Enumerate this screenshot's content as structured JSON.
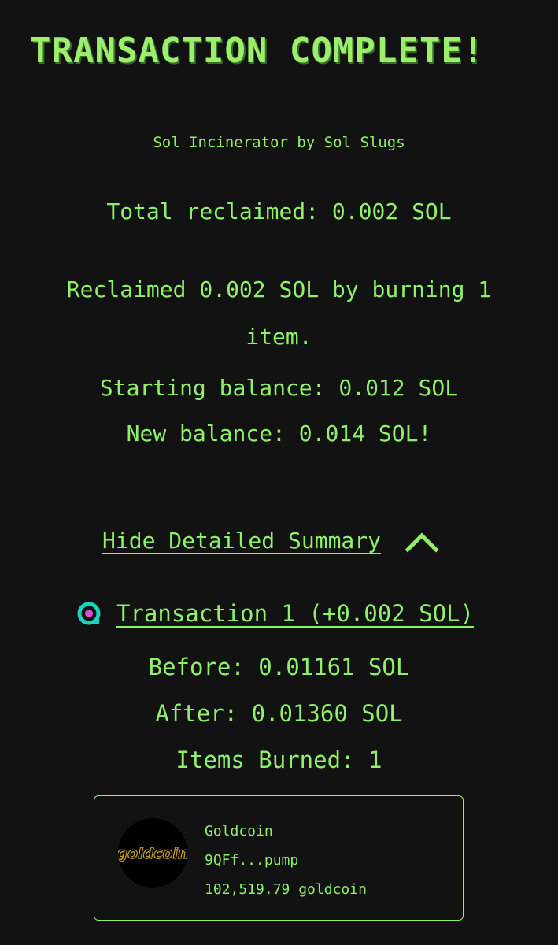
{
  "header": {
    "title": "TRANSACTION COMPLETE!",
    "subtitle": "Sol Incinerator by Sol Slugs"
  },
  "results": {
    "total_reclaimed": "Total reclaimed: 0.002 SOL",
    "reclaimed_message": "Reclaimed 0.002 SOL by burning 1 item.",
    "starting_balance": "Starting balance: 0.012 SOL",
    "new_balance": "New balance: 0.014 SOL!"
  },
  "summary": {
    "toggle_label": "Hide Detailed Summary",
    "toggle_icon": "chevron-up-icon"
  },
  "transaction": {
    "link_label": "Transaction 1 (+0.002 SOL)",
    "icon": "explorer-icon",
    "before": "Before: 0.01161 SOL",
    "after": "After: 0.01360 SOL",
    "items_burned": "Items Burned: 1"
  },
  "token": {
    "name": "Goldcoin",
    "address": "9QFf...pump",
    "amount": "102,519.79 goldcoin",
    "logo_text": "goldcoin"
  },
  "colors": {
    "background": "#121212",
    "text": "#8ff06a",
    "icon_teal": "#19d3c5",
    "icon_pink": "#d64fd6",
    "logo_gold": "#c9a227"
  }
}
